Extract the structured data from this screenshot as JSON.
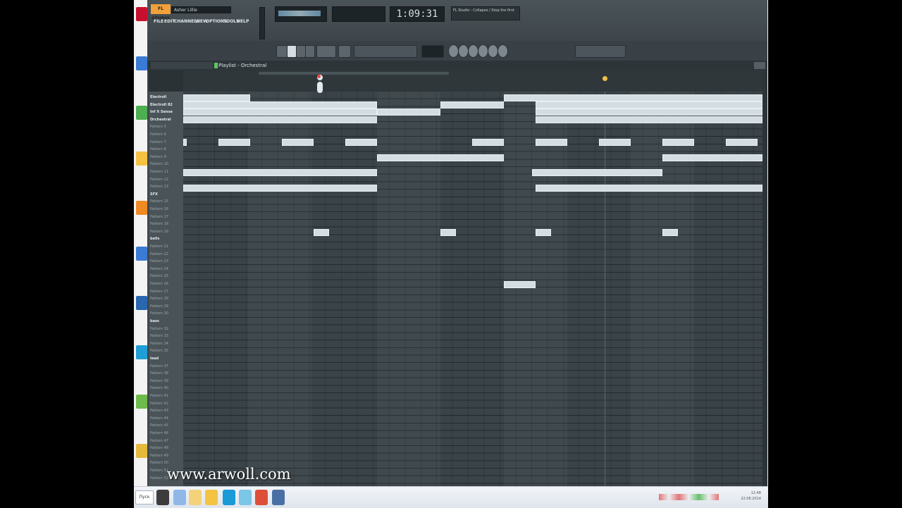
{
  "app": {
    "logo_text": "FL STUDIO",
    "project_title": "Asher Lillie",
    "menus": [
      "FILE",
      "EDIT",
      "CHANNELS",
      "VIEW",
      "OPTIONS",
      "TOOLS",
      "HELP"
    ],
    "time_display": "1:09:31",
    "hint_text": "FL Studio - Collapse / Stop the first"
  },
  "playlist": {
    "title": "Playlist - Orchestral",
    "tracks": [
      {
        "label": "Electroll",
        "category": true
      },
      {
        "label": "Electroll 82",
        "category": true
      },
      {
        "label": "Inf X Sense",
        "category": true
      },
      {
        "label": "Orchestral",
        "category": true
      },
      {
        "label": "Pattern 5",
        "category": false
      },
      {
        "label": "Pattern 6",
        "category": false
      },
      {
        "label": "Pattern 7",
        "category": false
      },
      {
        "label": "Pattern 8",
        "category": false
      },
      {
        "label": "Pattern 9",
        "category": false
      },
      {
        "label": "Pattern 10",
        "category": false
      },
      {
        "label": "Pattern 11",
        "category": false
      },
      {
        "label": "Pattern 12",
        "category": false
      },
      {
        "label": "Pattern 13",
        "category": false
      },
      {
        "label": "SFX",
        "category": true
      },
      {
        "label": "Pattern 15",
        "category": false
      },
      {
        "label": "Pattern 16",
        "category": false
      },
      {
        "label": "Pattern 17",
        "category": false
      },
      {
        "label": "Pattern 18",
        "category": false
      },
      {
        "label": "Pattern 19",
        "category": false
      },
      {
        "label": "bells",
        "category": true
      },
      {
        "label": "Pattern 21",
        "category": false
      },
      {
        "label": "Pattern 22",
        "category": false
      },
      {
        "label": "Pattern 23",
        "category": false
      },
      {
        "label": "Pattern 24",
        "category": false
      },
      {
        "label": "Pattern 25",
        "category": false
      },
      {
        "label": "Pattern 26",
        "category": false
      },
      {
        "label": "Pattern 27",
        "category": false
      },
      {
        "label": "Pattern 28",
        "category": false
      },
      {
        "label": "Pattern 29",
        "category": false
      },
      {
        "label": "Pattern 30",
        "category": false
      },
      {
        "label": "bass",
        "category": true
      },
      {
        "label": "Pattern 32",
        "category": false
      },
      {
        "label": "Pattern 33",
        "category": false
      },
      {
        "label": "Pattern 34",
        "category": false
      },
      {
        "label": "Pattern 35",
        "category": false
      },
      {
        "label": "lead",
        "category": true
      },
      {
        "label": "Pattern 37",
        "category": false
      },
      {
        "label": "Pattern 38",
        "category": false
      },
      {
        "label": "Pattern 39",
        "category": false
      },
      {
        "label": "Pattern 40",
        "category": false
      },
      {
        "label": "Pattern 41",
        "category": false
      },
      {
        "label": "Pattern 42",
        "category": false
      },
      {
        "label": "Pattern 43",
        "category": false
      },
      {
        "label": "Pattern 44",
        "category": false
      },
      {
        "label": "Pattern 45",
        "category": false
      },
      {
        "label": "Pattern 46",
        "category": false
      },
      {
        "label": "Pattern 47",
        "category": false
      },
      {
        "label": "Pattern 48",
        "category": false
      },
      {
        "label": "Pattern 49",
        "category": false
      },
      {
        "label": "Pattern 50",
        "category": false
      },
      {
        "label": "Pattern 51",
        "category": false
      },
      {
        "label": "Pattern 52",
        "category": false
      }
    ]
  },
  "watermark": "www.arwoll.com",
  "taskbar": {
    "start_label": "Пуск",
    "clock_time": "12:48",
    "clock_date": "22.08.2014"
  }
}
